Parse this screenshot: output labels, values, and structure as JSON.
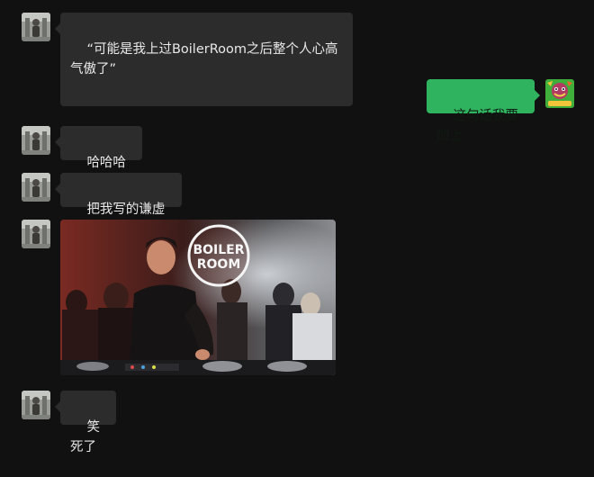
{
  "chat": {
    "messages": [
      {
        "side": "left",
        "type": "text",
        "text": "“可能是我上过BoilerRoom之后整个人心高气傲了”"
      },
      {
        "side": "right",
        "type": "text",
        "text": "这句话我要加上"
      },
      {
        "side": "left",
        "type": "text",
        "text": "哈哈哈哈哈"
      },
      {
        "side": "left",
        "type": "text",
        "text": "把我写的谦虚一点"
      },
      {
        "side": "left",
        "type": "image",
        "logo_line1": "BOILER",
        "logo_line2": "ROOM"
      },
      {
        "side": "left",
        "type": "text",
        "text": "笑死了"
      }
    ]
  },
  "colors": {
    "background": "#111111",
    "incoming_bubble": "#2c2c2c",
    "outgoing_bubble": "#2fb35f"
  }
}
